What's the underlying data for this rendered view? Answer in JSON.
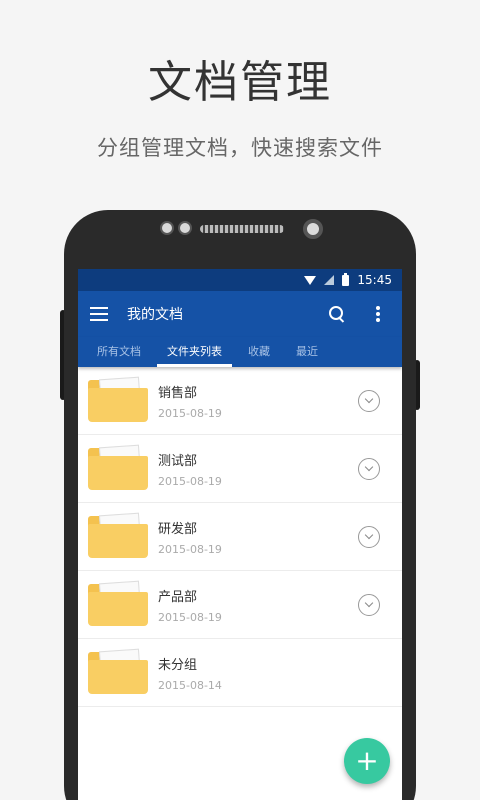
{
  "promo": {
    "headline": "文档管理",
    "subline": "分组管理文档，快速搜索文件"
  },
  "status_bar": {
    "time": "15:45",
    "icons": [
      "wifi-icon",
      "signal-icon",
      "battery-icon"
    ]
  },
  "app_bar": {
    "title": "我的文档",
    "icons": [
      "menu-icon",
      "search-icon",
      "more-vert-icon"
    ]
  },
  "tabs": [
    {
      "label": "所有文档",
      "active": false
    },
    {
      "label": "文件夹列表",
      "active": true
    },
    {
      "label": "收藏",
      "active": false
    },
    {
      "label": "最近",
      "active": false
    }
  ],
  "folders": [
    {
      "name": "销售部",
      "date": "2015-08-19",
      "has_menu": true
    },
    {
      "name": "测试部",
      "date": "2015-08-19",
      "has_menu": true
    },
    {
      "name": "研发部",
      "date": "2015-08-19",
      "has_menu": true
    },
    {
      "name": "产品部",
      "date": "2015-08-19",
      "has_menu": true
    },
    {
      "name": "未分组",
      "date": "2015-08-14",
      "has_menu": false
    }
  ],
  "fab": {
    "label": "+"
  },
  "colors": {
    "status_bar": "#0d3c7e",
    "app_bar": "#1552a6",
    "folder": "#f9ce63",
    "fab": "#37c9a0"
  }
}
